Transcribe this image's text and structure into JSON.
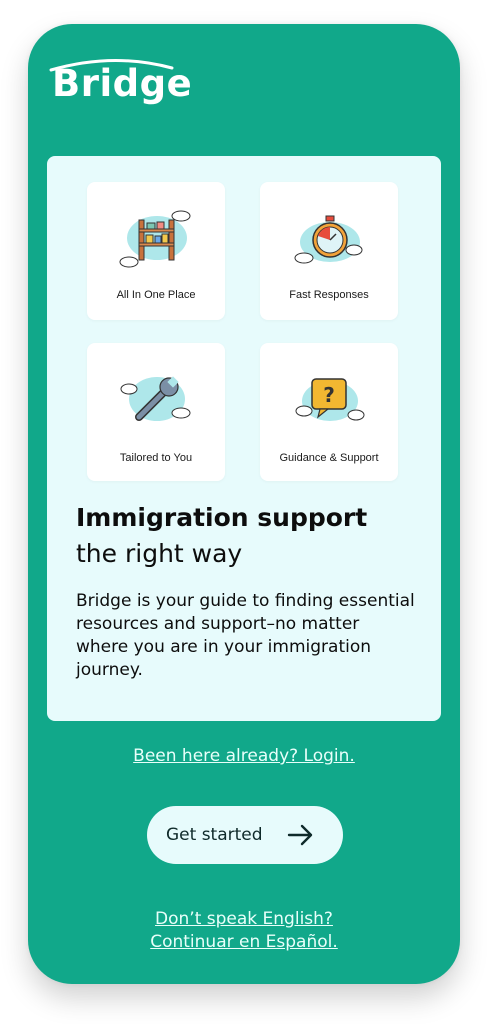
{
  "brand": {
    "name": "Bridge"
  },
  "features": [
    {
      "label": "All In One Place",
      "icon": "shelf-icon"
    },
    {
      "label": "Fast Responses",
      "icon": "stopwatch-icon"
    },
    {
      "label": "Tailored to You",
      "icon": "wrench-icon"
    },
    {
      "label": "Guidance & Support",
      "icon": "question-bubble-icon"
    }
  ],
  "hero": {
    "title_bold": "Immigration support",
    "title_rest": "the right way",
    "description": "Bridge is your guide to finding essential resources and support–no matter where you are in your immigration journey."
  },
  "login_link": "Been here already? Login.",
  "cta": {
    "label": "Get started",
    "icon": "arrow-right-icon"
  },
  "language": {
    "line1": "Don’t speak English?",
    "line2": "Continuar en Español."
  },
  "colors": {
    "background": "#11a88a",
    "card": "#e7fbfc",
    "tile": "#ffffff",
    "text_dark": "#0d0d0d",
    "link": "#e8fffa"
  }
}
